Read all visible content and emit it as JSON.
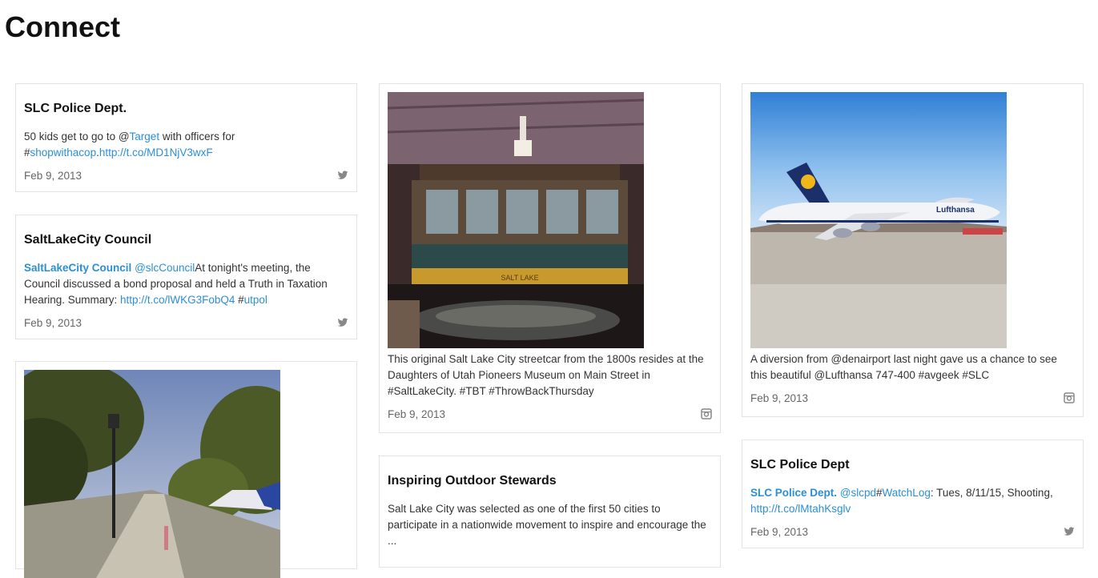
{
  "page": {
    "title": "Connect"
  },
  "cards": {
    "c1": {
      "title": "SLC Police Dept.",
      "t1": "50 kids get to go to @",
      "l1": "Target",
      "t2": " with officers for #",
      "l2": "shopwithacop",
      "t3": ".",
      "l3": "http://t.co/MD1NjV3wxF",
      "date": "Feb 9, 2013",
      "icon": "twitter-icon"
    },
    "c2": {
      "title": "SaltLakeCity Council",
      "l1": "SaltLakeCity Council",
      "t1": " ",
      "l2": "@slcCouncil",
      "t2": "At tonight's meeting, the Council discussed a bond proposal and held a Truth in Taxation Hearing. Summary: ",
      "l3": "http://t.co/lWKG3FobQ4",
      "t3": " #",
      "l4": "utpol",
      "date": "Feb 9, 2013",
      "icon": "twitter-icon"
    },
    "c4": {
      "text": "This original Salt Lake City streetcar from the 1800s resides at the Daughters of Utah Pioneers Museum on Main Street in #SaltLakeCity. #TBT #ThrowBackThursday",
      "date": "Feb 9, 2013",
      "icon": "instagram-icon",
      "photo_sign": "SALT LAKE"
    },
    "c5": {
      "title": "Inspiring Outdoor Stewards",
      "text": "Salt Lake City was selected as one of the first 50 cities to participate in a nationwide movement to inspire and encourage the ..."
    },
    "c6": {
      "text": "A diversion from @denairport last night gave us a chance to see this beautiful @Lufthansa 747-400 #avgeek #SLC",
      "date": "Feb 9, 2013",
      "icon": "instagram-icon",
      "photo_brand": "Lufthansa"
    },
    "c7": {
      "title": "SLC Police Dept",
      "l1": "SLC Police Dept.",
      "t1": " ",
      "l2": "@slcpd",
      "t2": "#",
      "l3": "WatchLog",
      "t3": ": Tues, 8/11/15, Shooting, ",
      "l4": "http://t.co/lMtahKsglv",
      "date": "Feb 9, 2013",
      "icon": "twitter-icon"
    }
  },
  "colors": {
    "link": "#2b8fd6",
    "border": "#e3e3e3"
  }
}
